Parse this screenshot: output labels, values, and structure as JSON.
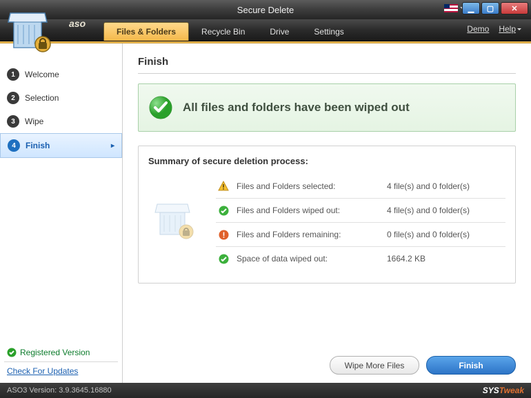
{
  "title": "Secure Delete",
  "brand": "aso",
  "tabs": [
    {
      "label": "Files & Folders",
      "active": true
    },
    {
      "label": "Recycle Bin",
      "active": false
    },
    {
      "label": "Drive",
      "active": false
    },
    {
      "label": "Settings",
      "active": false
    }
  ],
  "menu_links": {
    "demo": "Demo",
    "help": "Help"
  },
  "steps": [
    {
      "num": "1",
      "label": "Welcome",
      "active": false
    },
    {
      "num": "2",
      "label": "Selection",
      "active": false
    },
    {
      "num": "3",
      "label": "Wipe",
      "active": false
    },
    {
      "num": "4",
      "label": "Finish",
      "active": true
    }
  ],
  "registered": "Registered Version",
  "check_updates": "Check For Updates",
  "content": {
    "heading": "Finish",
    "banner": "All files and folders have been wiped out",
    "summary_title": "Summary of secure deletion process:",
    "rows": [
      {
        "icon": "warning",
        "label": "Files and Folders selected:",
        "value": "4 file(s) and 0 folder(s)"
      },
      {
        "icon": "success",
        "label": "Files and Folders wiped out:",
        "value": "4 file(s) and 0 folder(s)"
      },
      {
        "icon": "error",
        "label": "Files and Folders remaining:",
        "value": "0 file(s) and 0 folder(s)"
      },
      {
        "icon": "success",
        "label": "Space of data wiped out:",
        "value": "1664.2 KB"
      }
    ]
  },
  "buttons": {
    "wipe_more": "Wipe More Files",
    "finish": "Finish"
  },
  "version": "ASO3 Version: 3.9.3645.16880",
  "vendor": {
    "part1": "SYS",
    "part2": "Tweak"
  }
}
